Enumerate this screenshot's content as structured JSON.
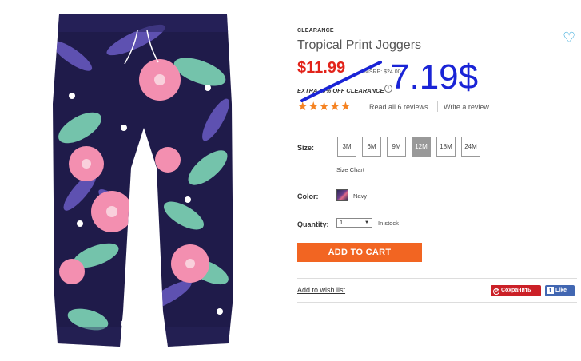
{
  "product": {
    "tag": "CLEARANCE",
    "title": "Tropical Print Joggers",
    "price": "$11.99",
    "msrp": "MSRP: $24.00",
    "extra_off": "EXTRA 40% OFF CLEARANCE",
    "info_glyph": "i",
    "stars": "★★★★★",
    "rating_stars": 5,
    "read_reviews": "Read all 6 reviews",
    "write_review": "Write a review",
    "wish_glyph": "♡"
  },
  "annotation": {
    "handwritten_price": "7.19$",
    "color": "#1a24d6"
  },
  "options": {
    "size_label": "Size:",
    "sizes": [
      "3M",
      "6M",
      "9M",
      "12M",
      "18M",
      "24M"
    ],
    "selected_size": "12M",
    "size_chart": "Size Chart",
    "color_label": "Color:",
    "color_name": "Navy",
    "quantity_label": "Quantity:",
    "quantity_value": "1",
    "stock_status": "In stock"
  },
  "actions": {
    "add_to_cart": "ADD TO CART",
    "add_to_wishlist": "Add to wish list",
    "pinterest": "Сохранить",
    "pin_glyph": "P",
    "facebook": "Like",
    "fb_glyph": "f"
  },
  "colors": {
    "price_red": "#e2231a",
    "star_orange": "#f58220",
    "cart_orange": "#f26522",
    "pinterest_red": "#cb2027",
    "facebook_blue": "#4267b2",
    "heart_blue": "#29a3d8"
  },
  "icons": {
    "heart": "heart-icon",
    "info": "info-icon",
    "star": "star-icon",
    "caret": "caret-down-icon"
  }
}
